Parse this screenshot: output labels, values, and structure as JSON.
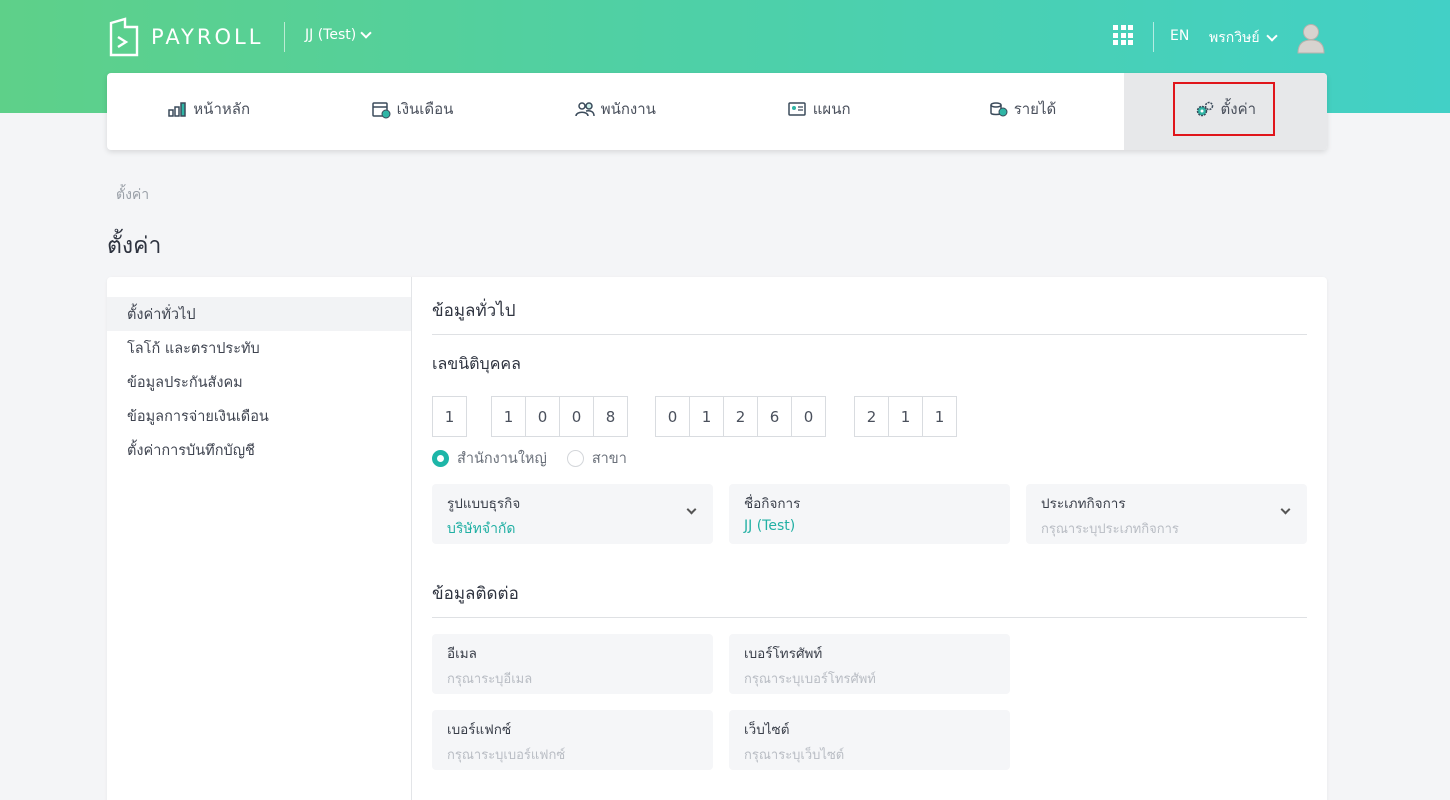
{
  "header": {
    "brand": "PAYROLL",
    "company": "JJ (Test)",
    "lang": "EN",
    "user_name": "พรกวิษย์"
  },
  "nav": {
    "items": [
      {
        "label": "หน้าหลัก",
        "icon": "bar-chart-icon"
      },
      {
        "label": "เงินเดือน",
        "icon": "calendar-money-icon"
      },
      {
        "label": "พนักงาน",
        "icon": "people-icon"
      },
      {
        "label": "แผนก",
        "icon": "id-card-icon"
      },
      {
        "label": "รายได้",
        "icon": "coins-icon"
      },
      {
        "label": "ตั้งค่า",
        "icon": "gears-icon",
        "active": true
      }
    ]
  },
  "breadcrumb": "ตั้งค่า",
  "page_title": "ตั้งค่า",
  "sidemenu": {
    "items": [
      "ตั้งค่าทั่วไป",
      "โลโก้ และตราประทับ",
      "ข้อมูลประกันสังคม",
      "ข้อมูลการจ่ายเงินเดือน",
      "ตั้งค่าการบันทึกบัญชี"
    ]
  },
  "general": {
    "title": "ข้อมูลทั่วไป",
    "tax_id_label": "เลขนิติบุคคล",
    "tax_id_groups": [
      [
        "1"
      ],
      [
        "1",
        "0",
        "0",
        "8"
      ],
      [
        "0",
        "1",
        "2",
        "6",
        "0"
      ],
      [
        "2",
        "1",
        "1"
      ]
    ],
    "radio_head_office": "สำนักงานใหญ่",
    "radio_branch": "สาขา",
    "business_type_label": "รูปแบบธุรกิจ",
    "business_type_value": "บริษัทจำกัด",
    "business_name_label": "ชื่อกิจการ",
    "business_name_value": "JJ (Test)",
    "business_category_label": "ประเภทกิจการ",
    "business_category_placeholder": "กรุณาระบุประเภทกิจการ"
  },
  "contact": {
    "title": "ข้อมูลติดต่อ",
    "email_label": "อีเมล",
    "email_placeholder": "กรุณาระบุอีเมล",
    "phone_label": "เบอร์โทรศัพท์",
    "phone_placeholder": "กรุณาระบุเบอร์โทรศัพท์",
    "fax_label": "เบอร์แฟกซ์",
    "fax_placeholder": "กรุณาระบุเบอร์แฟกซ์",
    "website_label": "เว็บไซต์",
    "website_placeholder": "กรุณาระบุเว็บไซต์"
  },
  "colors": {
    "accent": "#1db6a8",
    "header_start": "#5ed089",
    "header_end": "#42d0c6",
    "highlight": "#e0151b"
  }
}
